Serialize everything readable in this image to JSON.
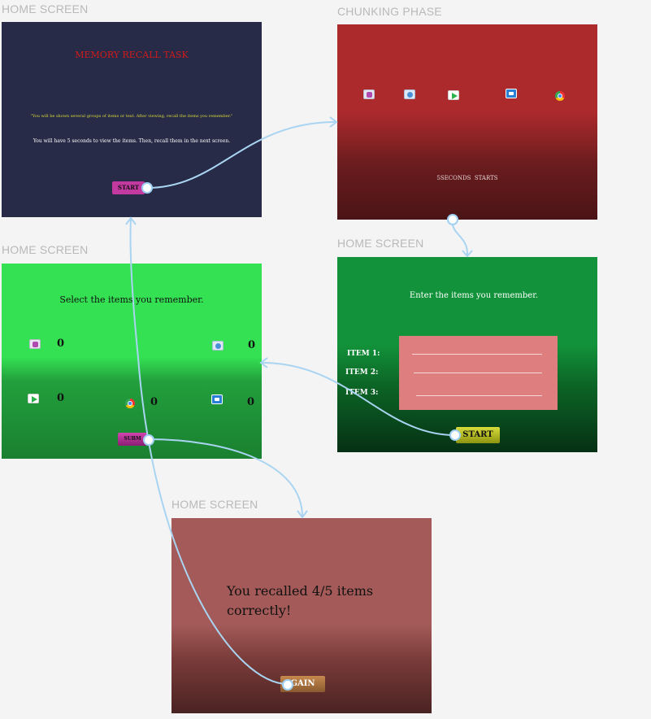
{
  "screens": {
    "home1": {
      "label": "HOME SCREEN",
      "title": "MEMORY RECALL TASK",
      "intro": "\"You will be shown several groups of items or text. After viewing, recall the items you remember.\"",
      "instructions": "You will have 5 seconds to view the items. Then, recall them in the next screen.",
      "button": "START"
    },
    "chunking": {
      "label": "CHUNKING PHASE",
      "icons": [
        "instagram-icon",
        "messenger-icon",
        "play-store-icon",
        "message-icon",
        "chrome-icon"
      ],
      "timer_text": "5SECONDS  STARTS"
    },
    "select": {
      "label": "HOME SCREEN",
      "heading": "Select the items you remember.",
      "counts": [
        "0",
        "0",
        "0",
        "0",
        "0"
      ],
      "button": "SUBM"
    },
    "enter": {
      "label": "HOME SCREEN",
      "heading": "Enter the items you remember.",
      "item1": "ITEM 1:",
      "item2": "ITEM 2:",
      "item3": "ITEM 3:",
      "button": "START"
    },
    "result": {
      "label": "HOME SCREEN",
      "message": "You recalled 4/5 items correctly!",
      "button": "GAIN"
    }
  },
  "colors": {
    "home1_bg": "#272b47",
    "chunking_top": "#ac2a2c",
    "chunking_bottom": "#4a1416",
    "select_top": "#34e153",
    "select_bottom": "#1a8030",
    "enter_top": "#12923a",
    "enter_bottom": "#063014",
    "result_top": "#a35a58",
    "result_bottom": "#4a2222",
    "connector": "#a9d4f2"
  }
}
